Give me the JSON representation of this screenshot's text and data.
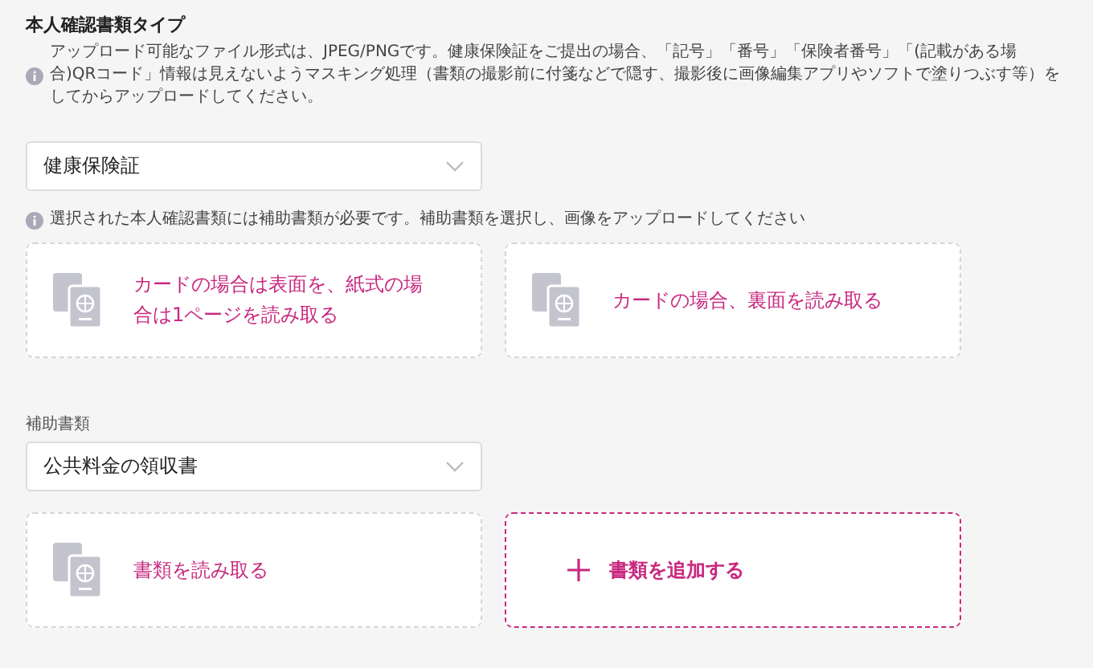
{
  "title": "本人確認書類タイプ",
  "notice": "アップロード可能なファイル形式は、JPEG/PNGです。健康保険証をご提出の場合、「記号」「番号」「保険者番号」「(記載がある場合)QRコード」情報は見えないようマスキング処理（書類の撮影前に付箋などで隠す、撮影後に画像編集アプリやソフトで塗りつぶす等）をしてからアップロードしてください。",
  "document_select": {
    "value": "健康保険証"
  },
  "hint": "選択された本人確認書類には補助書類が必要です。補助書類を選択し、画像をアップロードしてください",
  "document_cards": [
    {
      "kind": "upload",
      "label": "カードの場合は表面を、紙式の場合は1ページを読み取る"
    },
    {
      "kind": "upload",
      "label": "カードの場合、裏面を読み取る"
    }
  ],
  "supplement_label": "補助書類",
  "supplement_select": {
    "value": "公共料金の領収書"
  },
  "supplement_cards": [
    {
      "kind": "upload",
      "label": "書類を読み取る"
    },
    {
      "kind": "add",
      "label": "書類を追加する"
    }
  ]
}
